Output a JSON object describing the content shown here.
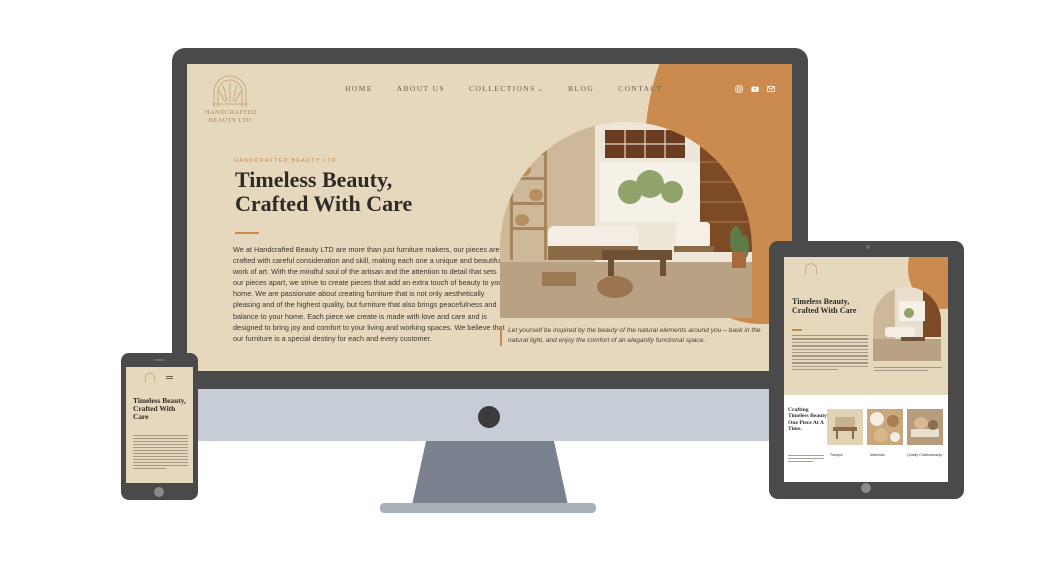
{
  "brand": {
    "logo_text_line1": "HANDCRAFTED",
    "logo_text_line2": "BEAUTY LTD",
    "accent_color": "#cb8a4e",
    "background_color": "#e5d8bc"
  },
  "nav": {
    "items": [
      {
        "label": "HOME"
      },
      {
        "label": "ABOUT US"
      },
      {
        "label": "COLLECTIONS",
        "has_dropdown": true
      },
      {
        "label": "BLOG"
      },
      {
        "label": "CONTACT"
      }
    ]
  },
  "socials": [
    "instagram-icon",
    "youtube-icon",
    "mail-icon"
  ],
  "hero": {
    "eyebrow": "HANDCRAFTED BEAUTY LTD",
    "title_line1": "Timeless Beauty,",
    "title_line2": "Crafted With Care",
    "body": "We at Handcrafted Beauty LTD are more than just furniture makers, our pieces are crafted with careful consideration and skill, making each one a unique and beautiful work of art. With the mindful soul of the artisan and the attention to detail that sets our pieces apart, we strive to create pieces that add an extra touch of beauty to your home. We are passionate about creating furniture that is not only aesthetically pleasing and of the highest quality, but furniture that also brings peacefulness and balance to your home. Each piece we create is made with love and care and is designed to bring joy and comfort to your living and working spaces. We believe that our furniture is a special destiny for each and every customer.",
    "caption": "Let yourself be inspired by the beauty of the natural elements around you – bask in the natural light, and enjoy the comfort of an elegantly functional space."
  },
  "tablet": {
    "title": "Timeless Beauty, Crafted With Care",
    "section_title": "Crafting Timeless Beauty, One Piece At A Time.",
    "tile_labels": [
      "Tranquil",
      "Materials",
      "Quality Craftsmanship"
    ]
  },
  "phone": {
    "title": "Timeless Beauty, Crafted With Care"
  }
}
